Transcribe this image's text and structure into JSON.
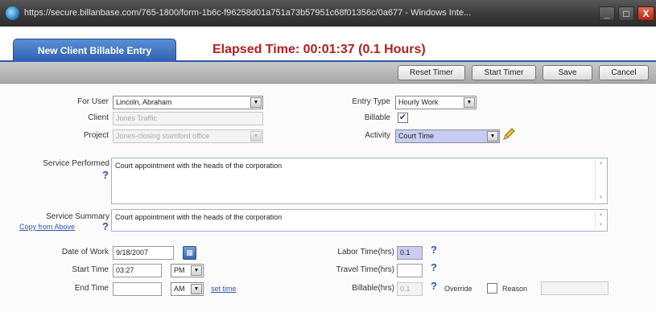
{
  "window": {
    "title": "https://secure.billanbase.com/765-1800/form-1b6c-f96258d01a751a73b57951c68f01356c/0a677 - Windows Inte...",
    "minimize_label": "_",
    "maximize_label": "□",
    "close_label": "X"
  },
  "header": {
    "tab_label": "New Client Billable Entry",
    "elapsed": "Elapsed Time: 00:01:37 (0.1 Hours)"
  },
  "toolbar": {
    "reset_timer": "Reset Timer",
    "start_timer": "Start Timer",
    "save": "Save",
    "cancel": "Cancel"
  },
  "form": {
    "for_user": {
      "label": "For User",
      "value": "Lincoln, Abraham"
    },
    "client": {
      "label": "Client",
      "placeholder": "Jones Traffic"
    },
    "project": {
      "label": "Project",
      "value": "Jones-closing stamford office"
    },
    "entry_type": {
      "label": "Entry Type",
      "value": "Hourly Work"
    },
    "billable": {
      "label": "Billable",
      "checked": true,
      "mark": "✔"
    },
    "activity": {
      "label": "Activity",
      "value": "Court Time"
    },
    "service_performed": {
      "label": "Service Performed",
      "value": "Court appointment with the heads of the corporation"
    },
    "service_summary": {
      "label": "Service Summary",
      "value": "Court appointment with the heads of the corporation",
      "copy_link": "Copy from Above"
    },
    "date_of_work": {
      "label": "Date of Work",
      "value": "9/18/2007"
    },
    "start_time": {
      "label": "Start Time",
      "value": "03:27",
      "ampm": "PM"
    },
    "end_time": {
      "label": "End Time",
      "value": "",
      "ampm": "AM",
      "set_link": "set time"
    },
    "labor_time": {
      "label": "Labor Time(hrs)",
      "value": "0.1"
    },
    "travel_time": {
      "label": "Travel Time(hrs)",
      "value": ""
    },
    "billable_hrs": {
      "label": "Billable(hrs)",
      "value": "0.1"
    },
    "override": {
      "label": "Override"
    },
    "reason": {
      "label": "Reason",
      "value": ""
    },
    "help_mark": "?"
  },
  "icons": {
    "dropdown_arrow": "▼",
    "scroll_up": "▲",
    "scroll_down": "▼",
    "calendar": "▦"
  }
}
